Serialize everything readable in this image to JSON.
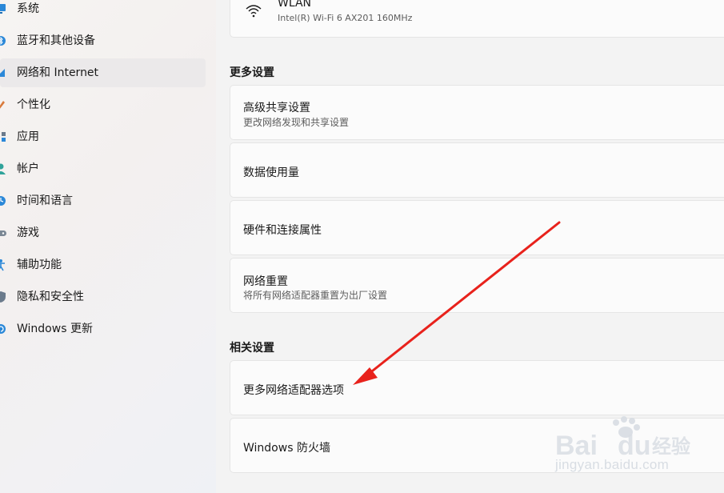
{
  "sidebar": {
    "items": [
      {
        "label": "系统",
        "icon": "monitor-icon"
      },
      {
        "label": "蓝牙和其他设备",
        "icon": "bluetooth-icon"
      },
      {
        "label": "网络和 Internet",
        "icon": "network-icon",
        "selected": true
      },
      {
        "label": "个性化",
        "icon": "brush-icon"
      },
      {
        "label": "应用",
        "icon": "apps-icon"
      },
      {
        "label": "帐户",
        "icon": "account-icon"
      },
      {
        "label": "时间和语言",
        "icon": "globe-clock-icon"
      },
      {
        "label": "游戏",
        "icon": "gamepad-icon"
      },
      {
        "label": "辅助功能",
        "icon": "accessibility-icon"
      },
      {
        "label": "隐私和安全性",
        "icon": "shield-icon"
      },
      {
        "label": "Windows 更新",
        "icon": "update-icon"
      }
    ]
  },
  "main": {
    "wlan": {
      "title": "WLAN",
      "subtitle": "Intel(R) Wi-Fi 6 AX201 160MHz",
      "icon": "wifi-icon"
    },
    "more_settings": {
      "header": "更多设置",
      "items": [
        {
          "title": "高级共享设置",
          "subtitle": "更改网络发现和共享设置"
        },
        {
          "title": "数据使用量"
        },
        {
          "title": "硬件和连接属性"
        },
        {
          "title": "网络重置",
          "subtitle": "将所有网络适配器重置为出厂设置"
        }
      ]
    },
    "related_settings": {
      "header": "相关设置",
      "items": [
        {
          "title": "更多网络适配器选项"
        },
        {
          "title": "Windows 防火墙"
        }
      ]
    }
  },
  "annotation": {
    "color": "#e8221c"
  },
  "watermark": {
    "logo_text": "Baidu经验",
    "url": "jingyan.baidu.com"
  },
  "colors": {
    "accent": "#0067c0",
    "background": "#f3f3f3",
    "card": "#fbfbfb"
  }
}
